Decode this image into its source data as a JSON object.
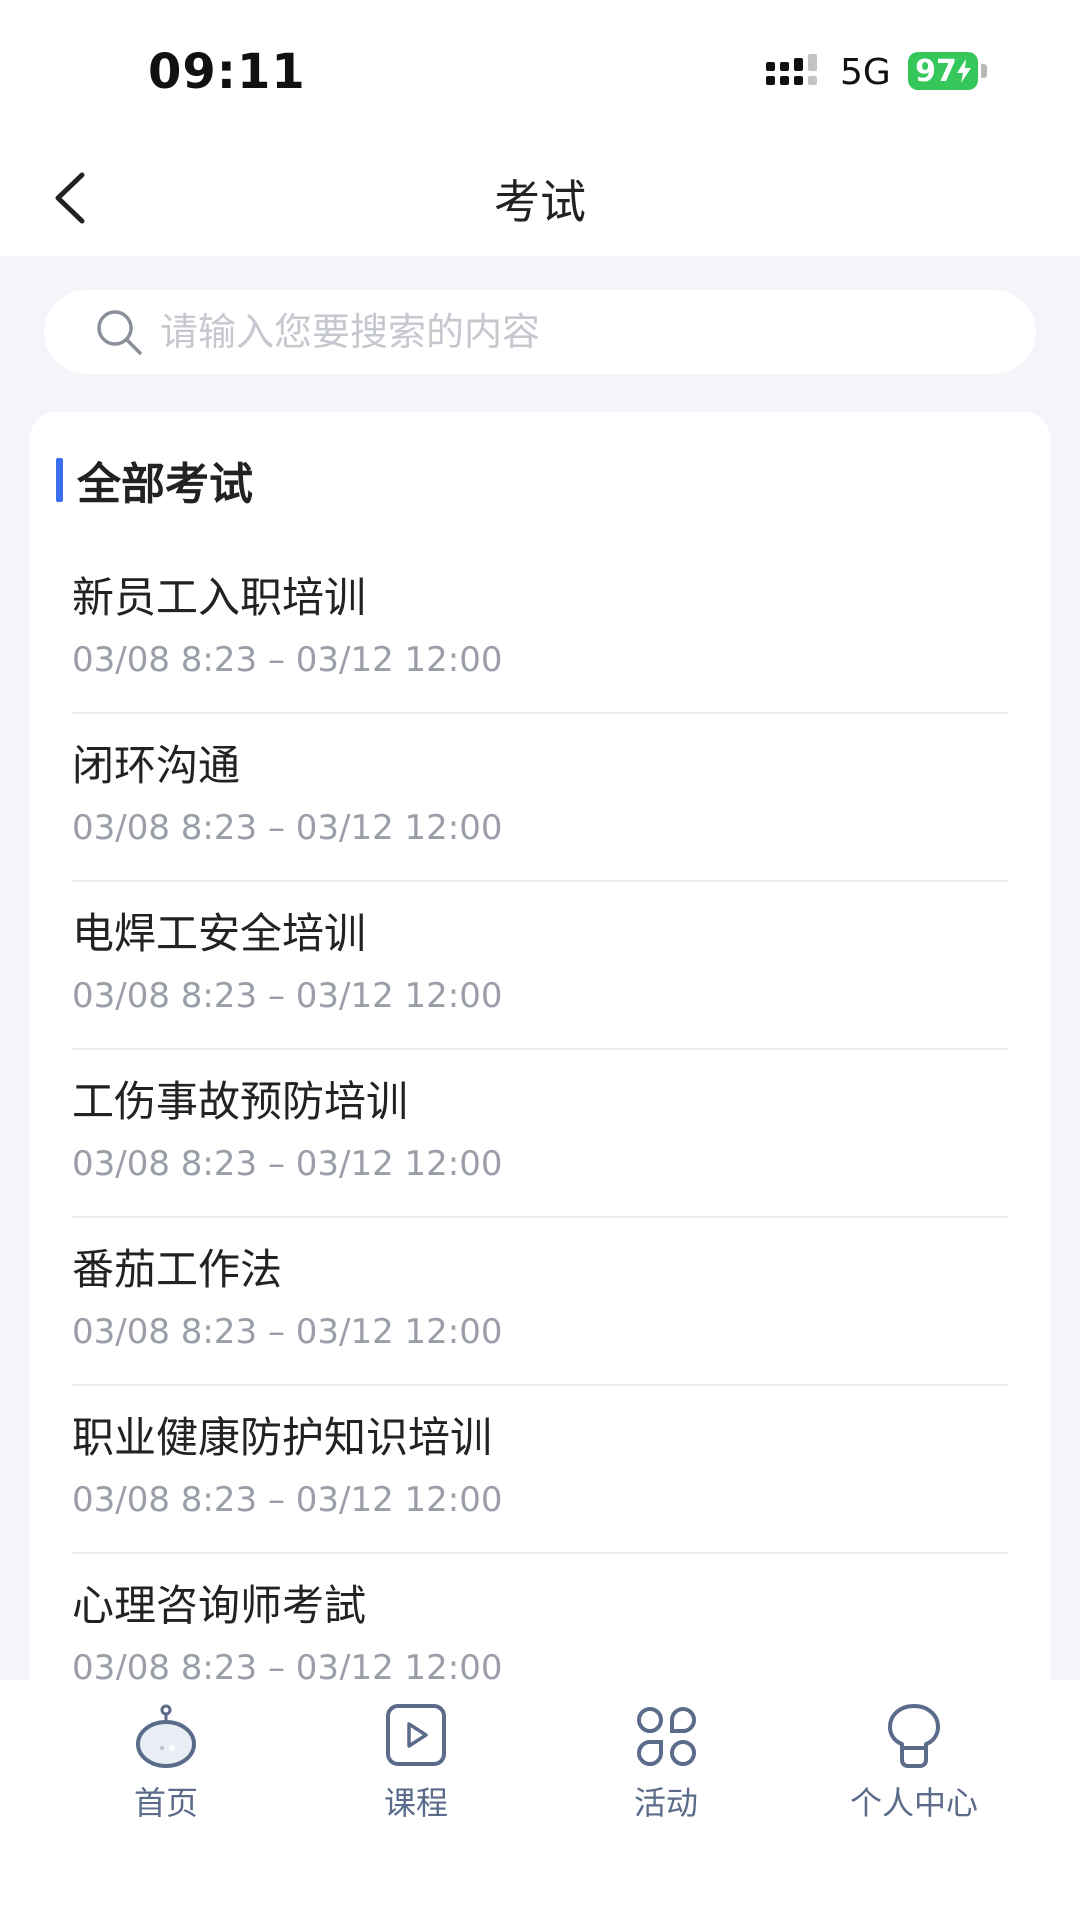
{
  "status_bar": {
    "time": "09:11",
    "network": "5G",
    "battery": "97"
  },
  "nav": {
    "title": "考试"
  },
  "search": {
    "placeholder": "请输入您要搜索的内容"
  },
  "section": {
    "title": "全部考试"
  },
  "exams": [
    {
      "name": "新员工入职培训",
      "time": "03/08 8:23 – 03/12 12:00"
    },
    {
      "name": "闭环沟通",
      "time": "03/08 8:23 – 03/12 12:00"
    },
    {
      "name": "电焊工安全培训",
      "time": "03/08 8:23 – 03/12 12:00"
    },
    {
      "name": "工伤事故预防培训",
      "time": "03/08 8:23 – 03/12 12:00"
    },
    {
      "name": "番茄工作法",
      "time": "03/08 8:23 – 03/12 12:00"
    },
    {
      "name": "职业健康防护知识培训",
      "time": "03/08 8:23 – 03/12 12:00"
    },
    {
      "name": "心理咨询师考試",
      "time": "03/08 8:23 – 03/12 12:00"
    }
  ],
  "tabs": [
    {
      "label": "首页",
      "icon": "home-icon"
    },
    {
      "label": "课程",
      "icon": "play-icon"
    },
    {
      "label": "活动",
      "icon": "grid-icon"
    },
    {
      "label": "个人中心",
      "icon": "profile-icon"
    }
  ],
  "colors": {
    "accent": "#3a6ff0",
    "battery": "#35c759",
    "tab_label": "#5b6b8a"
  }
}
